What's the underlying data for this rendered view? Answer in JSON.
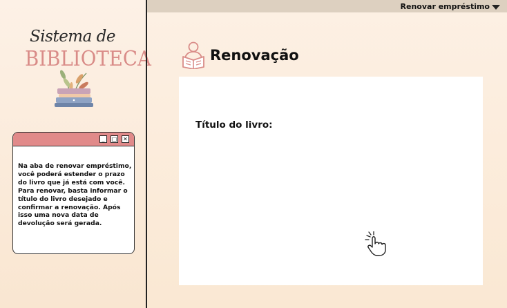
{
  "logo": {
    "script_text": "Sistema de",
    "main_text": "BIBLIOTECA"
  },
  "help_window": {
    "text": "Na aba de renovar empréstimo, você poderá estender o prazo do livro que já está com você. Para renovar, basta informar o título do livro desejado e confirmar a renovação. Após isso  uma nova data de devolução será gerada.",
    "buttons": {
      "minimize": "_",
      "maximize": "□",
      "close": "✕"
    }
  },
  "topbar": {
    "menu_label": "Renovar empréstimo"
  },
  "page": {
    "title": "Renovação",
    "title_icon": "reading-person-icon"
  },
  "form": {
    "book_title_label": "Título do livro:",
    "book_title_value": ""
  },
  "colors": {
    "accent_pink": "#e18a8a",
    "logo_pink": "#d98c88",
    "topbar": "#ddd0c0",
    "background": "#fae8d3"
  },
  "icons": {
    "pointer": "hand-pointer-icon"
  }
}
